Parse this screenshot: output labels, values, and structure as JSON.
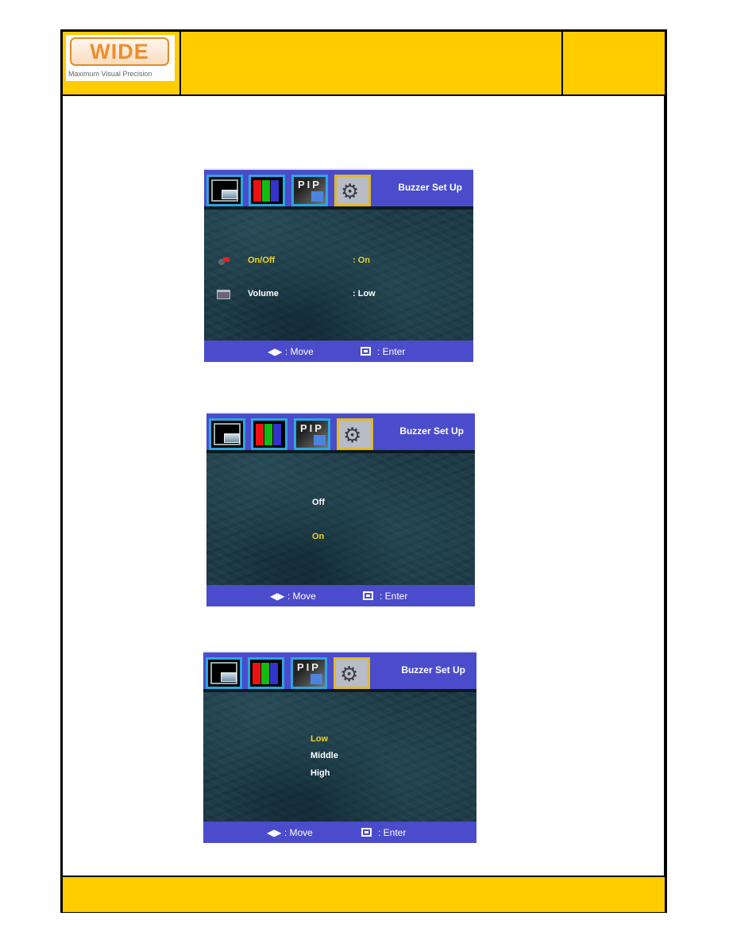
{
  "header": {
    "logo_text": "WIDE",
    "logo_tagline": "Maximum Visual Precision",
    "brand_color": "#ffcc00"
  },
  "osd_common": {
    "title": "Buzzer Set Up",
    "tabs": [
      {
        "name": "position",
        "icon": "position-icon"
      },
      {
        "name": "color",
        "icon": "rgb-bars-icon"
      },
      {
        "name": "pip",
        "icon": "pip-icon",
        "label": "PIP"
      },
      {
        "name": "setup",
        "icon": "gear-icon",
        "selected": true
      }
    ],
    "hint_move_icon": "◀▶",
    "hint_move": ": Move",
    "hint_enter": ": Enter",
    "accent": "#4a4ccc",
    "highlight_color": "#f2d21c"
  },
  "screens": [
    {
      "items": [
        {
          "label": "On/Off",
          "value": ": On",
          "icon": "speaker-icon",
          "selected": true
        },
        {
          "label": "Volume",
          "value": ": Low",
          "icon": "volume-icon",
          "selected": false
        }
      ]
    },
    {
      "options": [
        {
          "label": "Off",
          "selected": false
        },
        {
          "label": "On",
          "selected": true
        }
      ]
    },
    {
      "options": [
        {
          "label": "Low",
          "selected": true
        },
        {
          "label": "Middle",
          "selected": false
        },
        {
          "label": "High",
          "selected": false
        }
      ]
    }
  ]
}
